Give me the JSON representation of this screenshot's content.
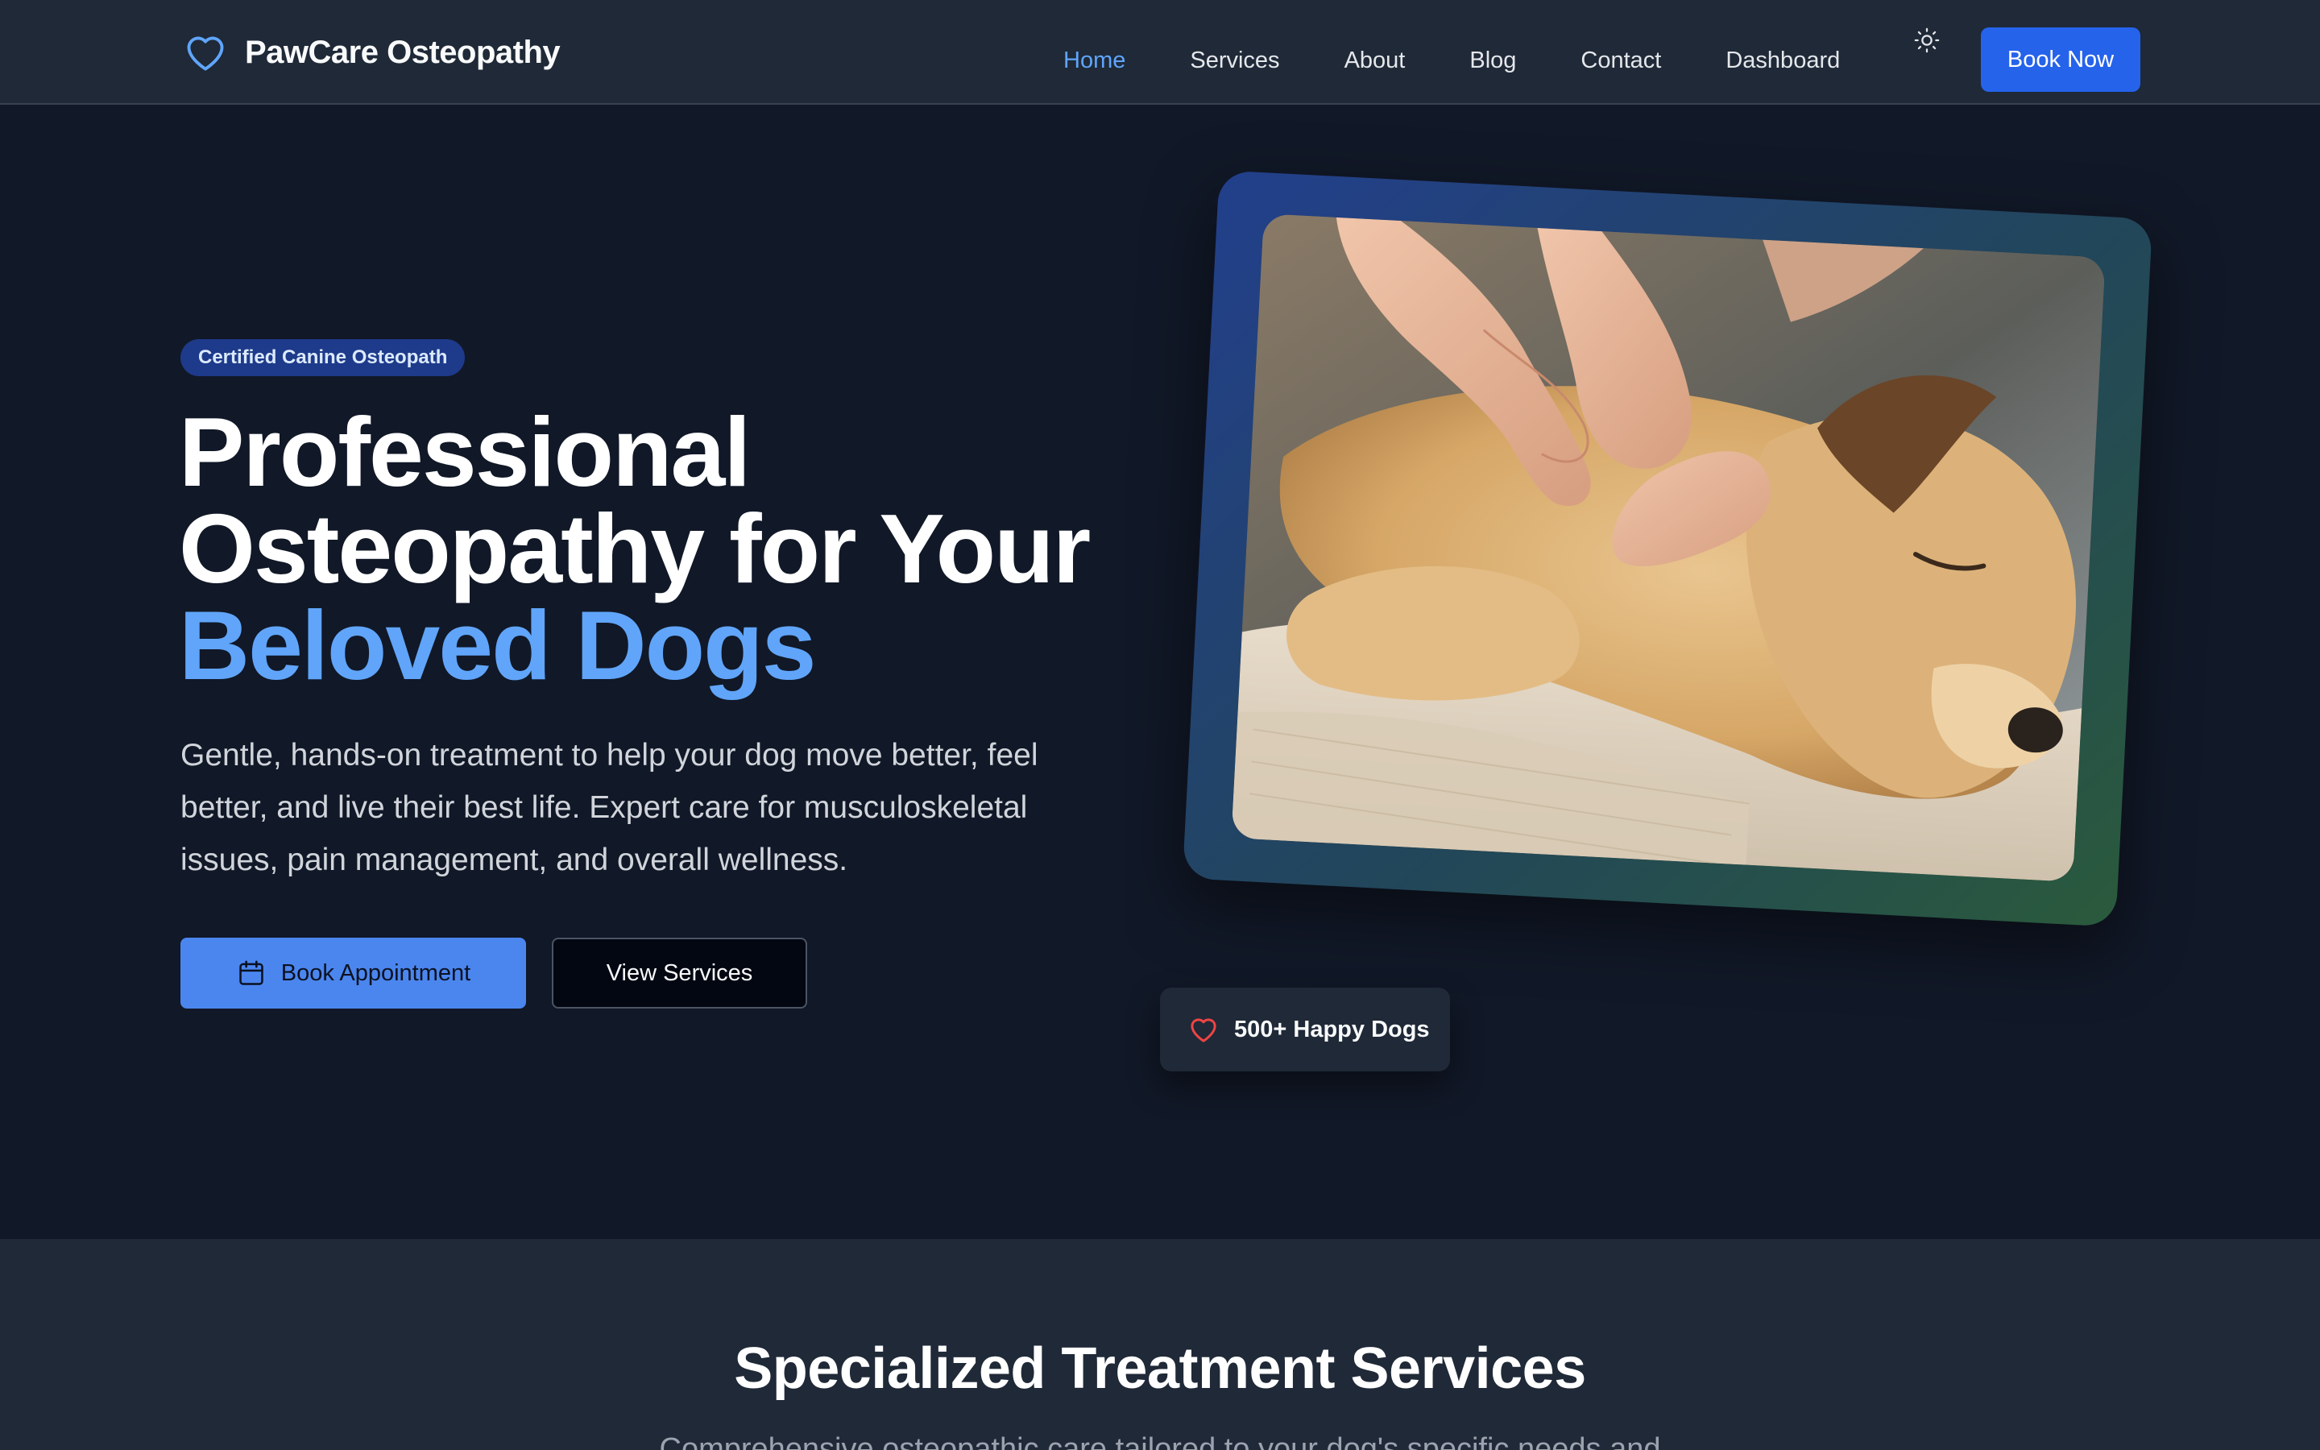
{
  "header": {
    "brand": "PawCare Osteopathy",
    "logo_icon": "heart-icon",
    "nav": [
      {
        "label": "Home",
        "active": true
      },
      {
        "label": "Services",
        "active": false
      },
      {
        "label": "About",
        "active": false
      },
      {
        "label": "Blog",
        "active": false
      },
      {
        "label": "Contact",
        "active": false
      },
      {
        "label": "Dashboard",
        "active": false
      }
    ],
    "theme_toggle_icon": "sun-icon",
    "book_now_label": "Book Now"
  },
  "hero": {
    "badge": "Certified Canine Osteopath",
    "title_line1": "Professional",
    "title_line2": "Osteopathy for Your",
    "title_line3": "Beloved Dogs",
    "description": "Gentle, hands-on treatment to help your dog move better, feel better, and live their best life. Expert care for musculoskeletal issues, pain management, and overall wellness.",
    "primary_button": "Book Appointment",
    "primary_button_icon": "calendar-icon",
    "secondary_button": "View Services",
    "stat_icon": "heart-icon",
    "stat_text": "500+ Happy Dogs"
  },
  "services": {
    "title": "Specialized Treatment Services",
    "subtitle": "Comprehensive osteopathic care tailored to your dog's specific needs and"
  },
  "colors": {
    "background": "#111827",
    "header_bg": "#1f2937",
    "accent": "#60a5fa",
    "primary_button": "#4b86ef",
    "book_now": "#2563eb",
    "heart": "#ef4444"
  }
}
